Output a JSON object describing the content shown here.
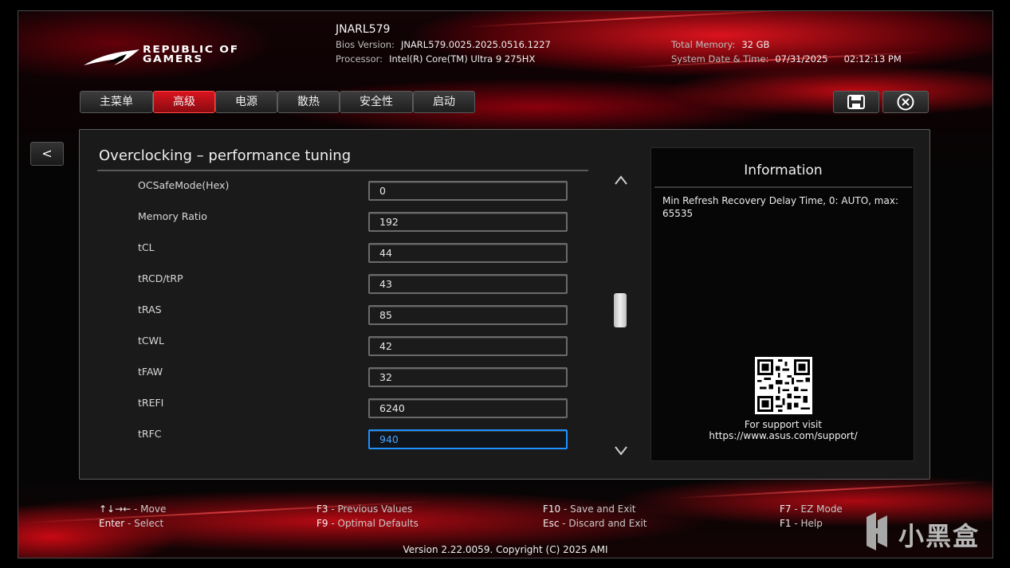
{
  "brand": {
    "logo_text_line1": "REPUBLIC OF",
    "logo_text_line2": "GAMERS"
  },
  "header": {
    "model": "JNARL579",
    "bios_version_label": "Bios Version:",
    "bios_version": "JNARL579.0025.2025.0516.1227",
    "processor_label": "Processor:",
    "processor": "Intel(R) Core(TM) Ultra 9 275HX",
    "total_memory_label": "Total Memory:",
    "total_memory": "32 GB",
    "datetime_label": "System Date & Time:",
    "date": "07/31/2025",
    "time": "02:12:13 PM"
  },
  "tabs": [
    {
      "label": "主菜单",
      "active": false
    },
    {
      "label": "高级",
      "active": true
    },
    {
      "label": "电源",
      "active": false
    },
    {
      "label": "散热",
      "active": false
    },
    {
      "label": "安全性",
      "active": false
    },
    {
      "label": "启动",
      "active": false
    }
  ],
  "toolbar": {
    "save_icon": "save-icon",
    "exit_icon": "close-circle-icon"
  },
  "back_label": "<",
  "section": {
    "title": "Overclocking – performance tuning",
    "rows": [
      {
        "label": "OCSafeMode(Hex)",
        "value": "0"
      },
      {
        "label": "Memory Ratio",
        "value": "192"
      },
      {
        "label": "tCL",
        "value": "44"
      },
      {
        "label": "tRCD/tRP",
        "value": "43"
      },
      {
        "label": "tRAS",
        "value": "85"
      },
      {
        "label": "tCWL",
        "value": "42"
      },
      {
        "label": "tFAW",
        "value": "32"
      },
      {
        "label": "tREFI",
        "value": "6240"
      },
      {
        "label": "tRFC",
        "value": "940"
      }
    ],
    "selected_row": "tRFC"
  },
  "info": {
    "title": "Information",
    "text": "Min Refresh Recovery Delay Time, 0: AUTO, max: 65535",
    "support_line1": "For support visit",
    "support_line2": "https://www.asus.com/support/"
  },
  "hints": {
    "move_keys": "↑↓→←",
    "move_label": " - Move",
    "enter_key": "Enter",
    "enter_label": " - Select",
    "f3_key": "F3",
    "f3_label": " - Previous Values",
    "f9_key": "F9",
    "f9_label": " - Optimal Defaults",
    "f10_key": "F10",
    "f10_label": " - Save and Exit",
    "esc_key": "Esc",
    "esc_label": " - Discard and Exit",
    "f7_key": "F7",
    "f7_label": " - EZ Mode",
    "f1_key": "F1",
    "f1_label": " - Help"
  },
  "footer": {
    "version": "Version 2.22.0059. Copyright (C) 2025 AMI"
  },
  "watermark": {
    "text": "小黑盒"
  },
  "colors": {
    "accent_red": "#d9141e",
    "selection_blue": "#1e90ff"
  }
}
